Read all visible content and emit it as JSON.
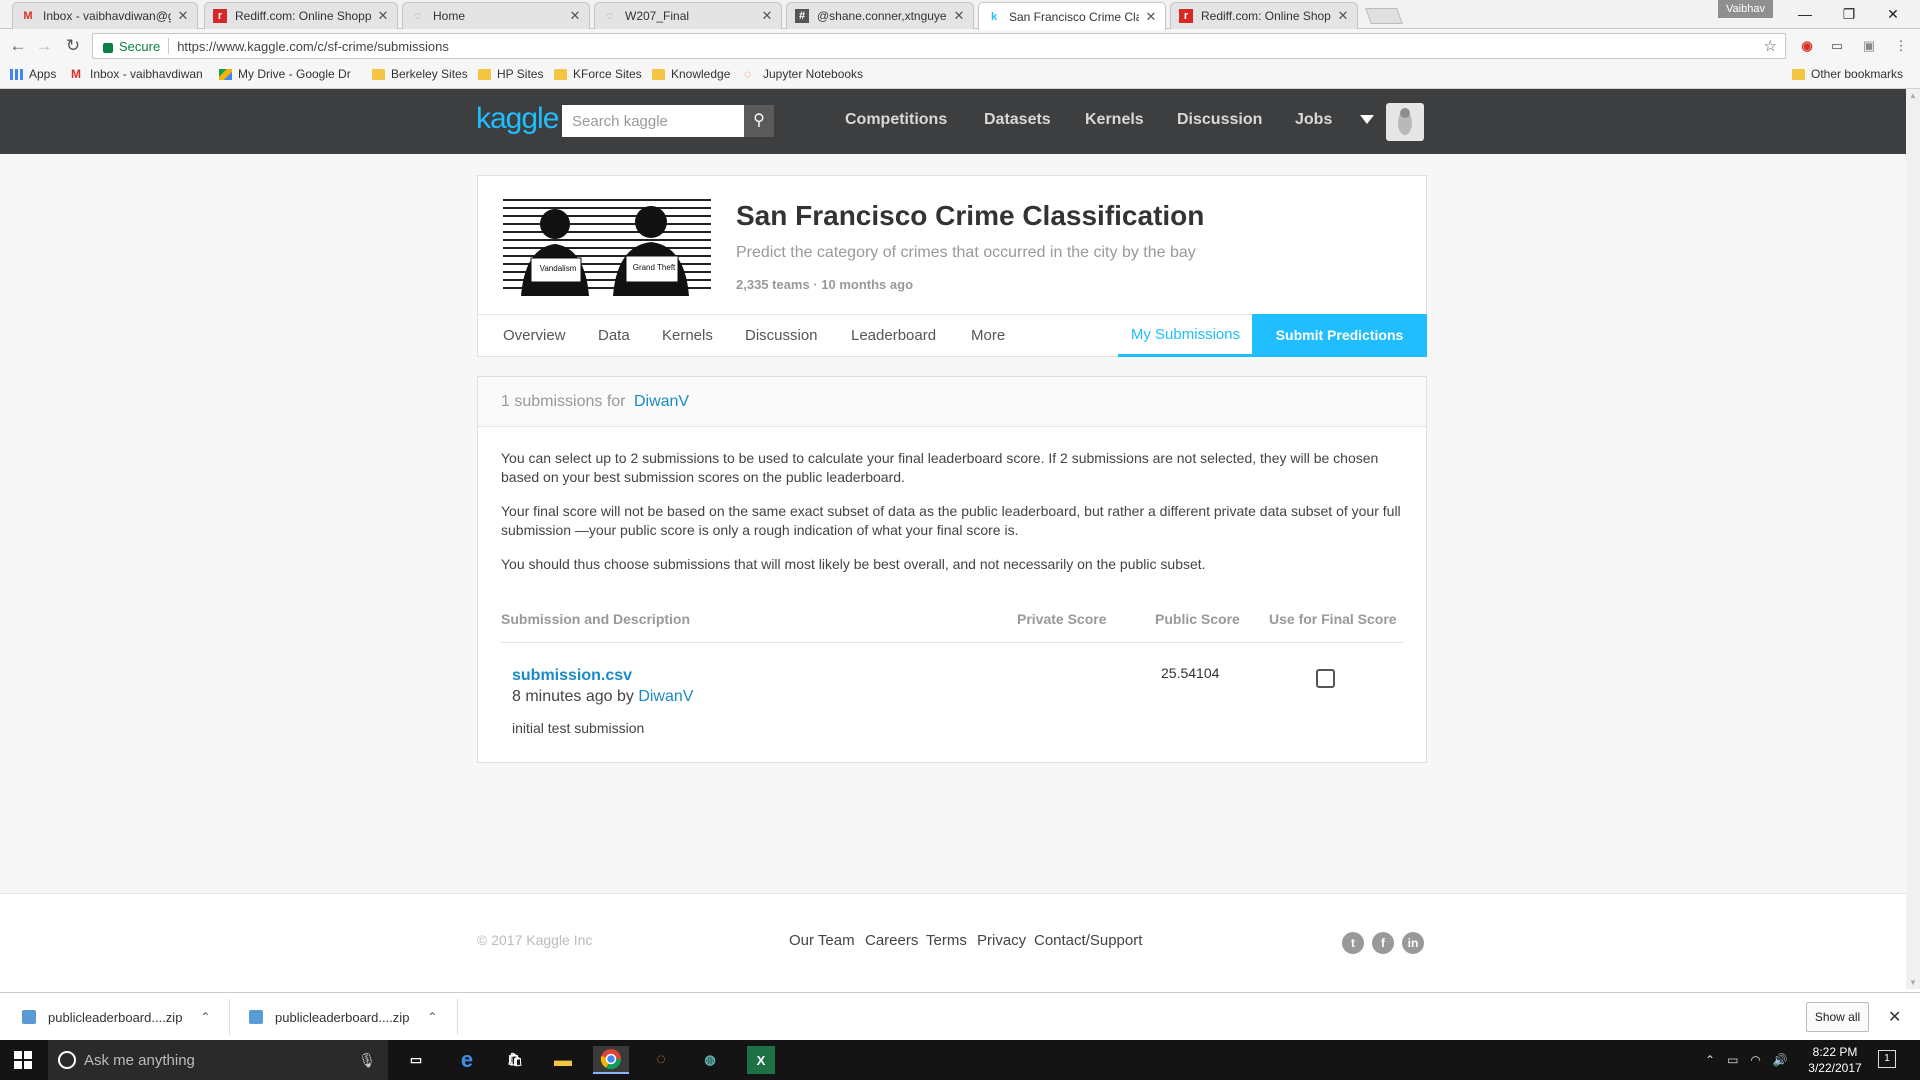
{
  "browser": {
    "tabs": [
      {
        "title": "Inbox - vaibhavdiwan@g",
        "favicon": "gmail-icon",
        "color": "#d93025",
        "glyph": "M"
      },
      {
        "title": "Rediff.com: Online Shopp",
        "favicon": "rediff-icon",
        "color": "#d72828",
        "glyph": "r"
      },
      {
        "title": "Home",
        "favicon": "jupyter-icon",
        "color": "#f37726",
        "glyph": "◌"
      },
      {
        "title": "W207_Final",
        "favicon": "jupyter-icon",
        "color": "#f37726",
        "glyph": "◌"
      },
      {
        "title": "@shane.conner,xtnguyer",
        "favicon": "slack-icon",
        "color": "#555555",
        "glyph": "#"
      },
      {
        "title": "San Francisco Crime Clas",
        "favicon": "kaggle-icon",
        "color": "#20beff",
        "glyph": "k"
      },
      {
        "title": "Rediff.com: Online Shopp",
        "favicon": "rediff-icon",
        "color": "#d72828",
        "glyph": "r"
      }
    ],
    "profile_name": "Vaibhav",
    "secure_label": "Secure",
    "url": "https://www.kaggle.com/c/sf-crime/submissions",
    "bookmarks": [
      {
        "label": "Apps",
        "icon": "apps-grid-icon"
      },
      {
        "label": "Inbox - vaibhavdiwan",
        "icon": "gmail-icon"
      },
      {
        "label": "My Drive - Google Dr",
        "icon": "drive-icon"
      },
      {
        "label": "Berkeley Sites",
        "icon": "folder-icon"
      },
      {
        "label": "HP Sites",
        "icon": "folder-icon"
      },
      {
        "label": "KForce Sites",
        "icon": "folder-icon"
      },
      {
        "label": "Knowledge",
        "icon": "folder-icon"
      },
      {
        "label": "Jupyter Notebooks",
        "icon": "jupyter-icon"
      }
    ],
    "other_bookmarks": "Other bookmarks"
  },
  "kaggle_nav": {
    "logo": "kaggle",
    "search_placeholder": "Search kaggle",
    "links": [
      "Competitions",
      "Datasets",
      "Kernels",
      "Discussion",
      "Jobs"
    ]
  },
  "competition": {
    "title": "San Francisco Crime Classification",
    "subtitle": "Predict the category of crimes that occurred in the city by the bay",
    "meta": "2,335 teams · 10 months ago",
    "sign_left": "Vandalism",
    "sign_right": "Grand Theft",
    "tabs": [
      "Overview",
      "Data",
      "Kernels",
      "Discussion",
      "Leaderboard",
      "More"
    ],
    "my_submissions": "My Submissions",
    "submit_predictions": "Submit Predictions"
  },
  "submissions": {
    "count_text": "1 submissions for",
    "user": "DiwanV",
    "paragraphs": [
      "You can select up to 2 submissions to be used to calculate your final leaderboard score. If 2 submissions are not selected, they will be chosen based on your best submission scores on the public leaderboard.",
      "Your final score will not be based on the same exact subset of data as the public leaderboard, but rather a different private data subset of your full submission —your public score is only a rough indication of what your final score is.",
      "You should thus choose submissions that will most likely be best overall, and not necessarily on the public subset."
    ],
    "columns": [
      "Submission and Description",
      "Private Score",
      "Public Score",
      "Use for Final Score"
    ],
    "rows": [
      {
        "file": "submission.csv",
        "when": "8 minutes ago by",
        "by": "DiwanV",
        "description": "initial test submission",
        "private_score": "",
        "public_score": "25.54104",
        "use_for_final": false
      }
    ]
  },
  "footer": {
    "copyright": "© 2017 Kaggle Inc",
    "links": [
      "Our Team",
      "Careers",
      "Terms",
      "Privacy",
      "Contact/Support"
    ],
    "social": [
      "twitter-icon",
      "facebook-icon",
      "linkedin-icon"
    ]
  },
  "downloads": {
    "items": [
      "publicleaderboard....zip",
      "publicleaderboard....zip"
    ],
    "show_all": "Show all"
  },
  "taskbar": {
    "search_placeholder": "Ask me anything",
    "time": "8:22 PM",
    "date": "3/22/2017",
    "notifications": "1"
  },
  "colors": {
    "kaggle_blue": "#20beff",
    "link_blue": "#1a8bc7",
    "nav_bg": "#3d3e40"
  }
}
